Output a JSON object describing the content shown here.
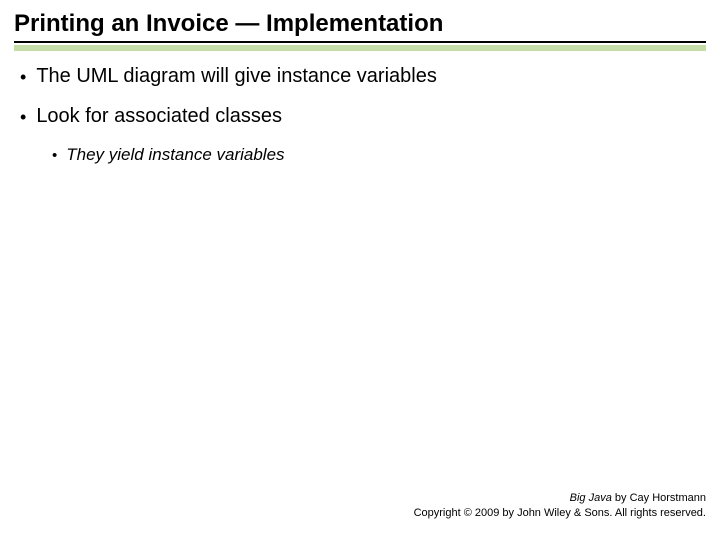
{
  "title": "Printing an Invoice — Implementation",
  "bullets": {
    "item1": "The UML diagram will give instance variables",
    "item2": "Look for associated classes",
    "sub1": "They yield instance variables"
  },
  "footer": {
    "line1_book": "Big Java",
    "line1_rest": " by Cay Horstmann",
    "line2": "Copyright © 2009 by John Wiley & Sons. All rights reserved."
  }
}
